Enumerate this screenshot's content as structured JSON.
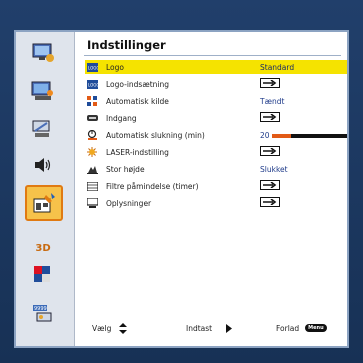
{
  "panel": {
    "title": "Indstillinger"
  },
  "sidebar": {
    "items": [
      {
        "name": "image-settings-icon"
      },
      {
        "name": "display-settings-icon"
      },
      {
        "name": "projector-settings-icon"
      },
      {
        "name": "audio-icon"
      },
      {
        "name": "settings-icon",
        "active": true
      },
      {
        "name": "3d-icon",
        "label": "3D"
      },
      {
        "name": "network-icon"
      },
      {
        "name": "options-icon"
      }
    ]
  },
  "rows": [
    {
      "label": "Logo",
      "value": "Standard"
    },
    {
      "label": "Logo-indsætning"
    },
    {
      "label": "Automatisk kilde",
      "value": "Tændt"
    },
    {
      "label": "Indgang"
    },
    {
      "label": "Automatisk slukning (min)",
      "value": "20",
      "level": 0.25
    },
    {
      "label": "LASER-indstilling"
    },
    {
      "label": "Stor højde",
      "value": "Slukket"
    },
    {
      "label": "Filtre påmindelse (timer)"
    },
    {
      "label": "Oplysninger"
    }
  ],
  "footer": {
    "select": "Vælg",
    "enter": "Indtast",
    "exit": "Forlad",
    "menu_badge": "Menu"
  },
  "colors": {
    "highlight": "#f5e300",
    "accent": "#e25a16",
    "active_tab": "#f6c24a"
  }
}
